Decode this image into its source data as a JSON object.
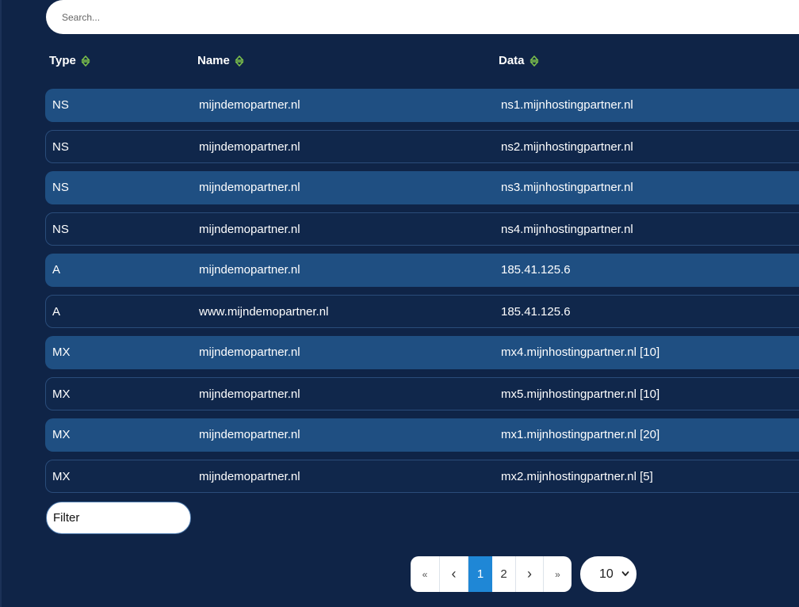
{
  "search": {
    "placeholder": "Search..."
  },
  "table": {
    "headers": {
      "type": "Type",
      "name": "Name",
      "data": "Data"
    },
    "rows": [
      {
        "type": "NS",
        "name": "mijndemopartner.nl",
        "data": "ns1.mijnhostingpartner.nl"
      },
      {
        "type": "NS",
        "name": "mijndemopartner.nl",
        "data": "ns2.mijnhostingpartner.nl"
      },
      {
        "type": "NS",
        "name": "mijndemopartner.nl",
        "data": "ns3.mijnhostingpartner.nl"
      },
      {
        "type": "NS",
        "name": "mijndemopartner.nl",
        "data": "ns4.mijnhostingpartner.nl"
      },
      {
        "type": "A",
        "name": "mijndemopartner.nl",
        "data": "185.41.125.6"
      },
      {
        "type": "A",
        "name": "www.mijndemopartner.nl",
        "data": "185.41.125.6"
      },
      {
        "type": "MX",
        "name": "mijndemopartner.nl",
        "data": "mx4.mijnhostingpartner.nl [10]"
      },
      {
        "type": "MX",
        "name": "mijndemopartner.nl",
        "data": "mx5.mijnhostingpartner.nl [10]"
      },
      {
        "type": "MX",
        "name": "mijndemopartner.nl",
        "data": "mx1.mijnhostingpartner.nl [20]"
      },
      {
        "type": "MX",
        "name": "mijndemopartner.nl",
        "data": "mx2.mijnhostingpartner.nl [5]"
      }
    ]
  },
  "filter": {
    "placeholder": "Filter"
  },
  "pagination": {
    "first": "«",
    "prev": "‹",
    "pages": [
      "1",
      "2"
    ],
    "current": "1",
    "next": "›",
    "last": "»"
  },
  "page_size": {
    "value": "10"
  },
  "icons": {
    "sort": "sort-icon",
    "chevron": "chevron-down-icon"
  },
  "colors": {
    "background": "#0f2447",
    "row_highlight": "#1f4f82",
    "active_page": "#1f87d6",
    "sort_icon": "#7cc04a"
  }
}
